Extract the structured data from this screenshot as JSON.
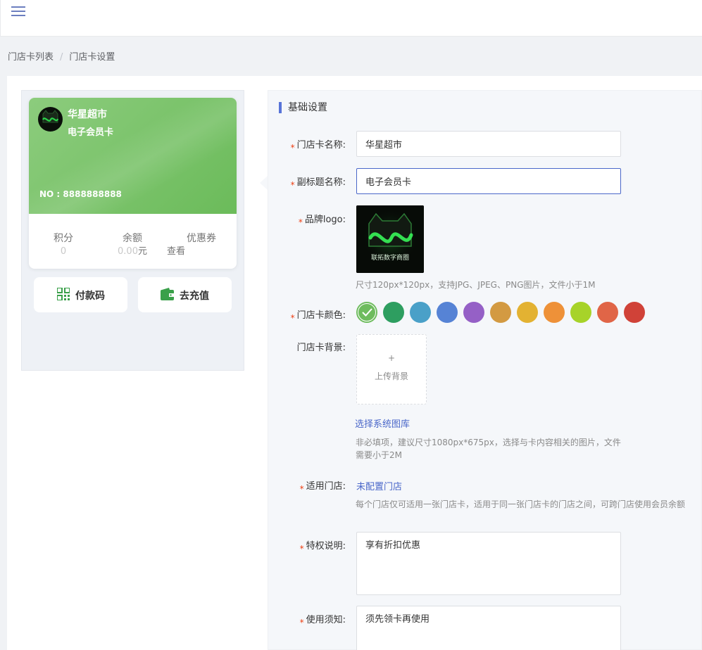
{
  "breadcrumb": {
    "item1": "门店卡列表",
    "sep": "/",
    "item2": "门店卡设置"
  },
  "card": {
    "name": "华星超市",
    "subtitle": "电子会员卡",
    "number": "NO : 8888888888",
    "stats": {
      "points_label": "积分",
      "points_value": "0",
      "balance_label": "余额",
      "balance_value": "0.00",
      "balance_unit": "元",
      "coupon_label": "优惠券",
      "coupon_value": "查看"
    },
    "logo_text": "联拓数字商圈",
    "pay_button": "付款码",
    "recharge_button": "去充值"
  },
  "form": {
    "section_title": "基础设置",
    "name_label": "门店卡名称:",
    "name_value": "华星超市",
    "subtitle_label": "副标题名称:",
    "subtitle_value": "电子会员卡",
    "logo_label": "品牌logo:",
    "logo_text": "联拓数字商圈",
    "logo_hint": "尺寸120px*120px，支持JPG、JPEG、PNG图片，文件小于1M",
    "color_label": "门店卡颜色:",
    "colors": [
      "#6ebc5e",
      "#2e9e60",
      "#4aa0c8",
      "#5683d5",
      "#9560c6",
      "#d39a42",
      "#e3b232",
      "#ee9138",
      "#a7d329",
      "#e06547",
      "#d04238"
    ],
    "bg_label": "门店卡背景:",
    "upload_plus": "+",
    "upload_text": "上传背景",
    "system_gallery_link": "选择系统图库",
    "bg_hint_line1": "非必填项，建议尺寸1080px*675px，选择与卡内容相关的图片，文件",
    "bg_hint_line2": "需要小于2M",
    "store_label": "适用门店:",
    "store_link": "未配置门店",
    "store_hint": "每个门店仅可适用一张门店卡，适用于同一张门店卡的门店之间，可跨门店使用会员余额",
    "privilege_label": "特权说明:",
    "privilege_value": "享有折扣优惠",
    "notice_label": "使用须知:",
    "notice_value": "须先领卡再使用",
    "required_mark": "*"
  }
}
